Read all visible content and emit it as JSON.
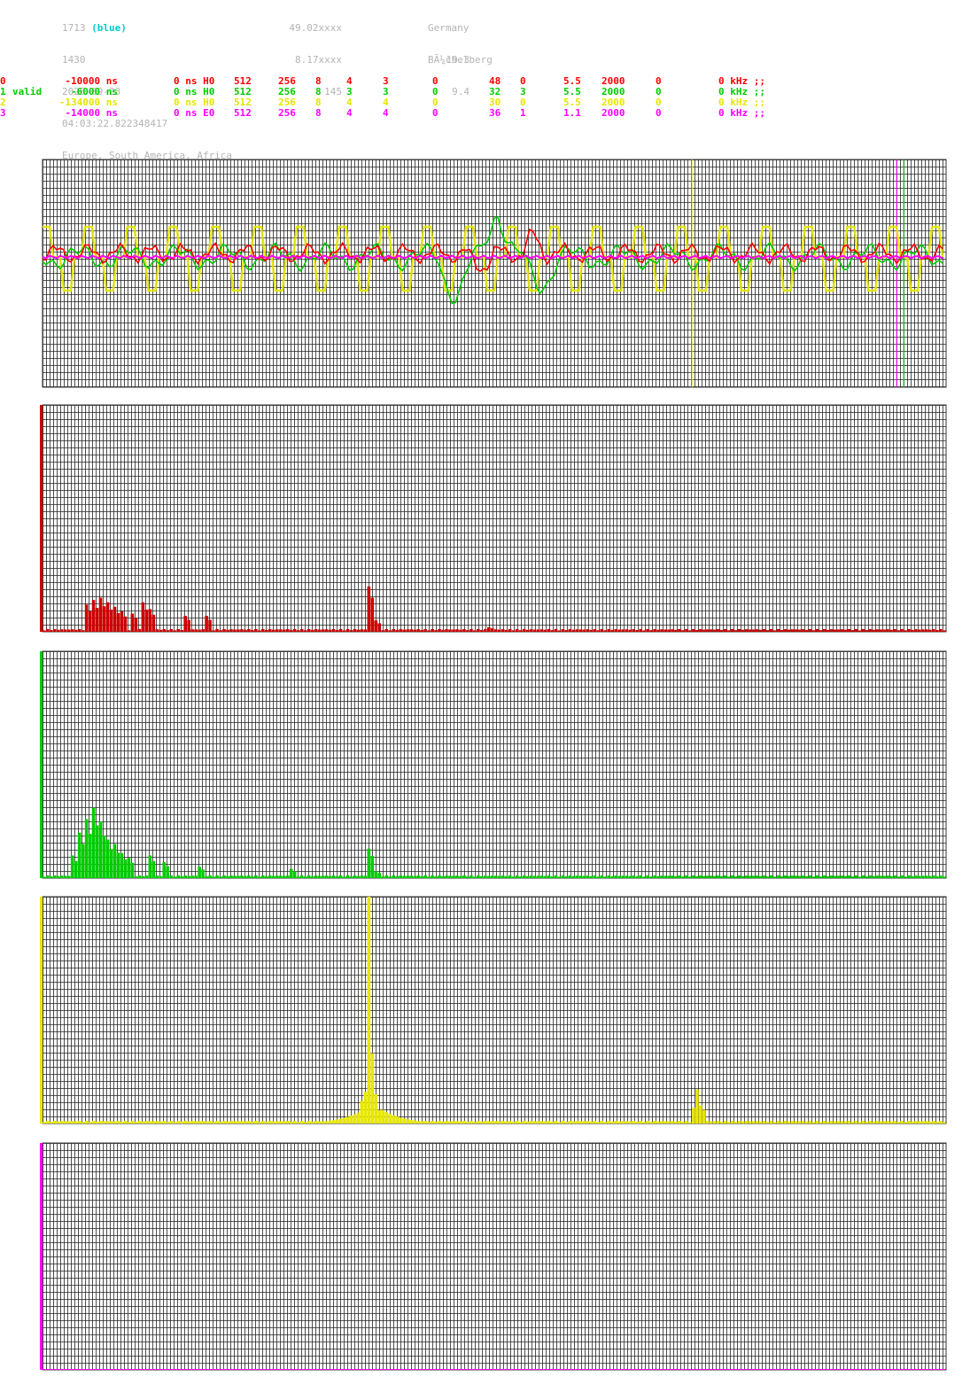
{
  "header": {
    "station_id": "1713",
    "station_color": "(blue)",
    "station_num": "1430",
    "date": "2026-09-23",
    "time": "04:03:22.822348417",
    "regions": "Europe, South America, Africa",
    "lat": "49.02xxxx",
    "lon": "8.17xxxx",
    "alt": "145",
    "country": "Germany",
    "place": "BÃ¼chelberg",
    "val1": "19.3",
    "val2": "9.4"
  },
  "channels": [
    {
      "color": "#ff0000",
      "cells": [
        "0",
        "",
        "-10000 ns",
        "0 ns H0",
        "512",
        "256",
        "8",
        "4",
        "3",
        "0",
        "48",
        "0",
        "5.5",
        "2000",
        "0",
        "0 kHz ;;"
      ]
    },
    {
      "color": "#00cc00",
      "cells": [
        "1",
        "valid",
        "-6000 ns",
        "0 ns H0",
        "512",
        "256",
        "8",
        "3",
        "3",
        "0",
        "32",
        "3",
        "5.5",
        "2000",
        "0",
        "0 kHz ;;"
      ]
    },
    {
      "color": "#e6e600",
      "cells": [
        "2",
        "",
        "-134000 ns",
        "0 ns H0",
        "512",
        "256",
        "8",
        "4",
        "4",
        "0",
        "30",
        "0",
        "5.5",
        "2000",
        "0",
        "0 kHz ;;"
      ]
    },
    {
      "color": "#ff00ff",
      "cells": [
        "3",
        "",
        "-14000 ns",
        "0 ns E0",
        "512",
        "256",
        "8",
        "4",
        "4",
        "0",
        "36",
        "1",
        "1.1",
        "2000",
        "0",
        "0 kHz ;;"
      ]
    }
  ],
  "chart_data": [
    {
      "type": "line",
      "title": "",
      "grid": true,
      "series": [
        {
          "color": "#ff0000",
          "character": "wavy baseline with small peak near center"
        },
        {
          "color": "#00cc00",
          "character": "wavy with large positive then negative spike at center"
        },
        {
          "color": "#e6e600",
          "character": "regular high-amplitude square-like oscillation"
        },
        {
          "color": "#ff00ff",
          "character": "nearly flat"
        }
      ],
      "markers": [
        {
          "color": "#e6e600",
          "x_bin": 184
        },
        {
          "color": "#ff00ff",
          "x_bin": 242
        },
        {
          "color": "#00cc00",
          "x_bin": 244
        }
      ]
    },
    {
      "type": "bar",
      "color": "#cc0000",
      "ylim": [
        0,
        100
      ],
      "peaks": [
        [
          12,
          12
        ],
        [
          14,
          14
        ],
        [
          16,
          15
        ],
        [
          18,
          13
        ],
        [
          20,
          11
        ],
        [
          22,
          9
        ],
        [
          25,
          8
        ],
        [
          28,
          13
        ],
        [
          30,
          10
        ],
        [
          40,
          7
        ],
        [
          46,
          7
        ],
        [
          92,
          20
        ],
        [
          94,
          5
        ],
        [
          126,
          2
        ]
      ]
    },
    {
      "type": "bar",
      "color": "#00cc00",
      "ylim": [
        0,
        100
      ],
      "peaks": [
        [
          8,
          10
        ],
        [
          10,
          20
        ],
        [
          12,
          26
        ],
        [
          14,
          31
        ],
        [
          16,
          25
        ],
        [
          18,
          17
        ],
        [
          20,
          15
        ],
        [
          22,
          11
        ],
        [
          24,
          9
        ],
        [
          30,
          10
        ],
        [
          34,
          7
        ],
        [
          44,
          5
        ],
        [
          70,
          4
        ],
        [
          92,
          13
        ],
        [
          94,
          3
        ]
      ]
    },
    {
      "type": "bar",
      "color": "#e6e600",
      "ylim": [
        0,
        100
      ],
      "peaks": [
        [
          90,
          10
        ],
        [
          91,
          14
        ],
        [
          92,
          100
        ],
        [
          93,
          31
        ],
        [
          94,
          13
        ],
        [
          95,
          6
        ],
        [
          184,
          7
        ],
        [
          185,
          15
        ],
        [
          186,
          8
        ]
      ]
    },
    {
      "type": "bar",
      "color": "#ff00ff",
      "ylim": [
        0,
        100
      ],
      "peaks": []
    }
  ]
}
